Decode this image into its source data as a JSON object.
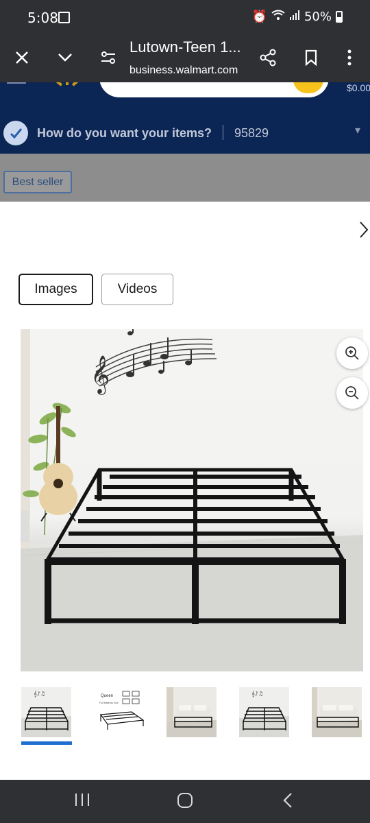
{
  "status": {
    "time": "5:08",
    "battery": "50%",
    "icons": [
      "image-icon",
      "alarm-icon",
      "wifi-icon",
      "signal-icon",
      "battery-icon"
    ]
  },
  "browser": {
    "title": "Lutown-Teen 1...",
    "url": "business.walmart.com"
  },
  "walmart": {
    "cart_total": "$0.00",
    "delivery_prompt": "How do you want your items?",
    "zip": "95829",
    "badge": "Best seller",
    "brand_color": "#0b2554",
    "accent_color": "#f7c21b"
  },
  "viewer": {
    "tabs": [
      {
        "label": "Images",
        "selected": true
      },
      {
        "label": "Videos",
        "selected": false
      }
    ],
    "selected_thumb": 0,
    "thumbs": [
      "bed-frame-room",
      "bed-frame-dimensions",
      "bed-frame-bedroom",
      "bed-frame-music-wall",
      "bed-frame-bedroom-2"
    ],
    "dimension_thumb": {
      "label": "Queen",
      "caption": "Full Mattress Size"
    },
    "underline_color": "#1f6fd1"
  }
}
